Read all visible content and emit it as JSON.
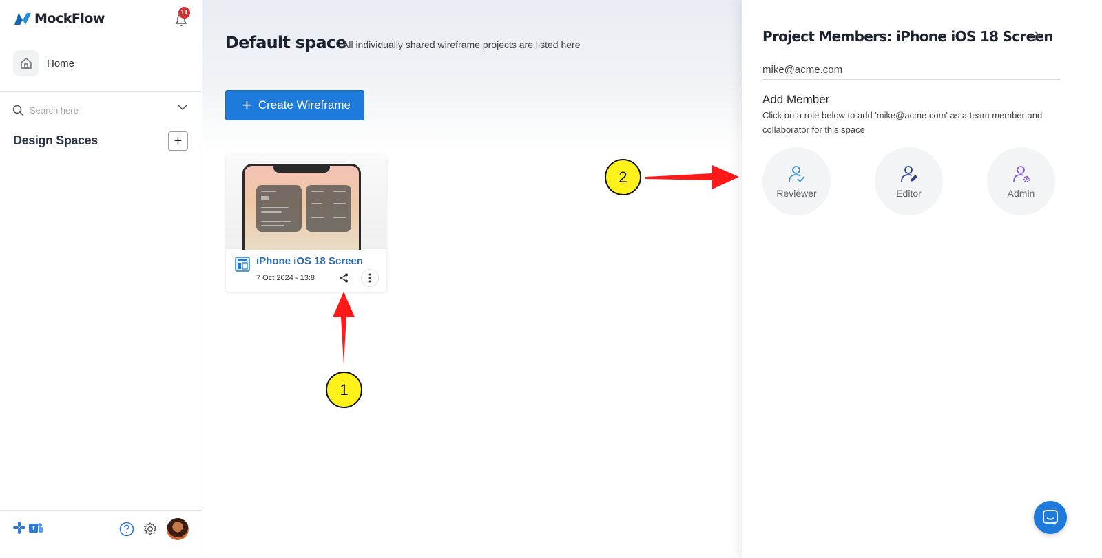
{
  "app": {
    "name": "MockFlow",
    "notification_count": "11"
  },
  "sidebar": {
    "home_label": "Home",
    "search_placeholder": "Search here",
    "design_spaces_title": "Design Spaces",
    "add_space_symbol": "+"
  },
  "main": {
    "title": "Default space",
    "subtitle": "All individually shared wireframe projects are listed here",
    "create_button_label": "Create Wireframe",
    "create_button_symbol": "+",
    "project_card": {
      "title": "iPhone iOS 18 Screen",
      "date": "7 Oct 2024 - 13:8"
    }
  },
  "panel": {
    "title": "Project Members: iPhone iOS 18 Screen",
    "email_value": "mike@acme.com",
    "add_member_title": "Add Member",
    "add_member_desc": "Click on a role below to add 'mike@acme.com' as a team member and collaborator for this space",
    "roles": [
      {
        "label": "Reviewer",
        "color": "#3a8fd8"
      },
      {
        "label": "Editor",
        "color": "#2c3e8c"
      },
      {
        "label": "Admin",
        "color": "#8b5cd6"
      }
    ]
  },
  "annotations": {
    "step1": "1",
    "step2": "2",
    "color": "#ff1a1a",
    "callout_fill": "#fff21a"
  },
  "colors": {
    "primary": "#1e7bdc",
    "badge": "#d32f2f",
    "card_title": "#2d6ab0"
  }
}
